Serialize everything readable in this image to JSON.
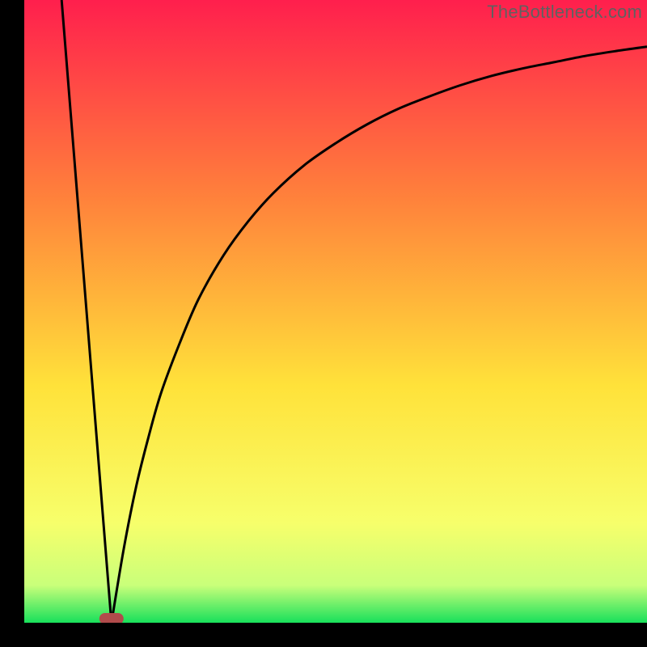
{
  "attribution": "TheBottleneck.com",
  "colors": {
    "gradient_top": "#ff1f4d",
    "gradient_upper_mid": "#ff823b",
    "gradient_mid": "#ffe23a",
    "gradient_lower_mid": "#f7ff6b",
    "gradient_lower": "#c9ff7a",
    "gradient_bottom": "#18e05b",
    "curve": "#000000",
    "marker_fill": "#b14b4b",
    "marker_stroke": "#7c2d2d",
    "frame": "#000000"
  },
  "chart_data": {
    "type": "line",
    "title": "",
    "xlabel": "",
    "ylabel": "",
    "xlim": [
      0,
      100
    ],
    "ylim": [
      0,
      100
    ],
    "optimum_x": 14,
    "marker": {
      "x": 14,
      "y": 0
    },
    "series": [
      {
        "name": "left-branch",
        "x": [
          6,
          7,
          8,
          9,
          10,
          11,
          12,
          13,
          14
        ],
        "values": [
          100,
          87.5,
          75,
          62.5,
          50,
          37.5,
          25,
          12.5,
          0
        ]
      },
      {
        "name": "right-branch",
        "x": [
          14,
          16,
          18,
          20,
          22,
          25,
          28,
          32,
          36,
          40,
          45,
          50,
          55,
          60,
          65,
          70,
          75,
          80,
          85,
          90,
          95,
          100
        ],
        "values": [
          0,
          12,
          22,
          30,
          37,
          45,
          52,
          59,
          64.5,
          69,
          73.5,
          77,
          80,
          82.5,
          84.5,
          86.3,
          87.8,
          89,
          90,
          91,
          91.8,
          92.5
        ]
      }
    ]
  }
}
